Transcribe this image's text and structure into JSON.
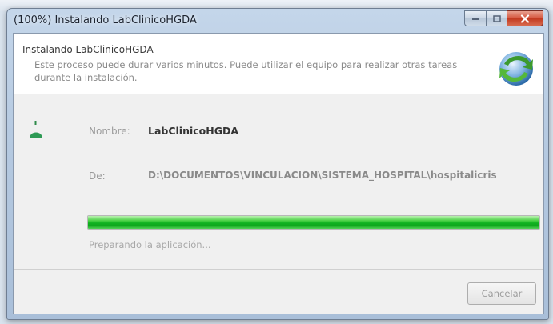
{
  "window": {
    "title": "(100%) Instalando LabClinicoHGDA"
  },
  "header": {
    "title": "Instalando LabClinicoHGDA",
    "description": "Este proceso puede durar varios minutos. Puede utilizar el equipo para realizar otras tareas durante la instalación."
  },
  "details": {
    "name_label": "Nombre:",
    "name_value": "LabClinicoHGDA",
    "from_label": "De:",
    "from_value": "D:\\DOCUMENTOS\\VINCULACION\\SISTEMA_HOSPITAL\\hospitalicris"
  },
  "progress": {
    "value": 1.0,
    "status": "Preparando la aplicación..."
  },
  "footer": {
    "cancel_label": "Cancelar"
  },
  "icons": {
    "caption_minimize": "minimize-icon",
    "caption_maximize": "maximize-icon",
    "caption_close": "close-icon",
    "installer_logo": "clickonce-installer-icon",
    "application": "application-icon"
  },
  "colors": {
    "progress_green": "#10b321",
    "close_button_red": "#c23a20"
  }
}
